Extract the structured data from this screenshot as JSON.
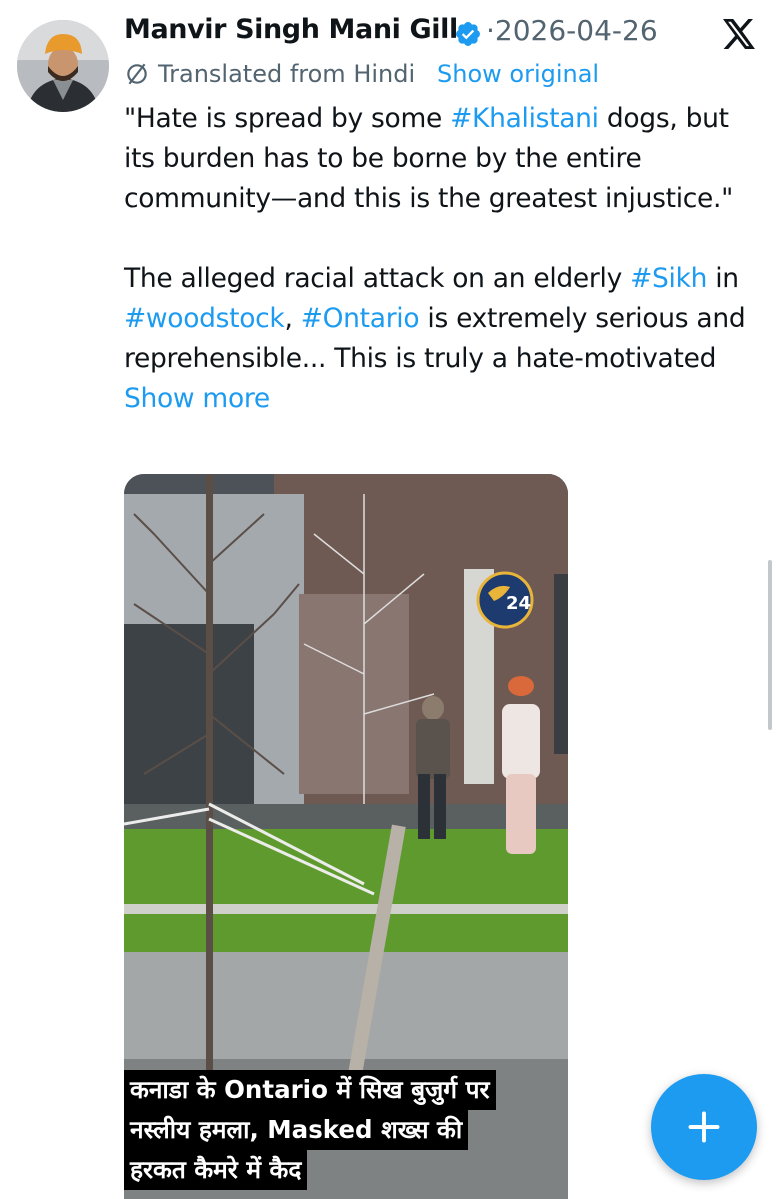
{
  "tweet": {
    "author_name": "Manvir Singh Mani Gill",
    "date": "2026-04-26",
    "date_separator": "·",
    "translated_label": "Translated from Hindi",
    "show_original": "Show original",
    "text_segments_1": [
      {
        "t": "\"Hate is spread by some ",
        "k": "text"
      },
      {
        "t": "#Khalistani",
        "k": "tag"
      },
      {
        "t": " dogs, but its burden has to be borne by the entire community—and this is the greatest injustice.\"",
        "k": "text"
      }
    ],
    "text_segments_2": [
      {
        "t": "The alleged racial attack on an elderly ",
        "k": "text"
      },
      {
        "t": "#Sikh",
        "k": "tag"
      },
      {
        "t": " in ",
        "k": "text"
      },
      {
        "t": "#woodstock",
        "k": "tag"
      },
      {
        "t": ", ",
        "k": "text"
      },
      {
        "t": "#Ontario",
        "k": "tag"
      },
      {
        "t": " is extremely serious and reprehensible... This is truly a hate-motivated ",
        "k": "text"
      },
      {
        "t": "Show more",
        "k": "more"
      }
    ]
  },
  "media": {
    "logo_text": "24",
    "caption_lines": [
      "कनाडा के Ontario में सिख बुजुर्ग पर",
      "नस्लीय हमला, Masked शख्स की",
      "हरकत कैमरे में कैद"
    ]
  },
  "icons": {
    "verified": "verified-badge-icon",
    "platform": "x-logo-icon",
    "translate": "globe-slash-icon",
    "compose": "plus-icon"
  },
  "colors": {
    "accent": "#1d9bf0",
    "text": "#0f1419",
    "secondary": "#536471"
  }
}
